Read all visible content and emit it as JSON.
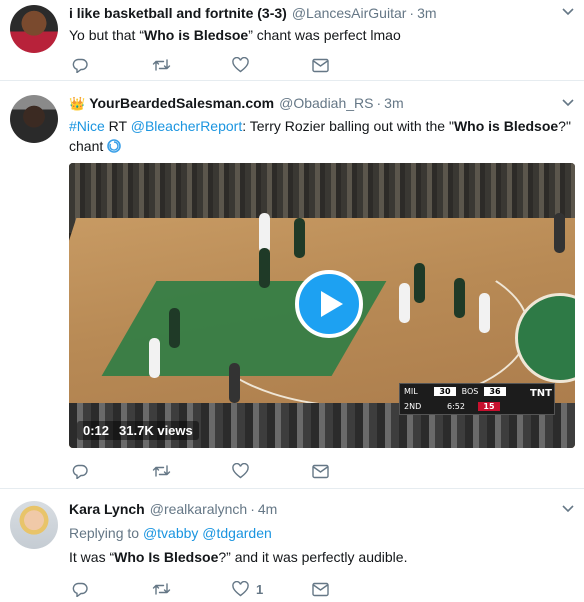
{
  "tweets": [
    {
      "name": "i like basketball and fortnite (3-3)",
      "handle": "@LancesAirGuitar",
      "dot": "·",
      "time": "3m",
      "text_a": "Yo but that “",
      "text_bold": "Who is Bledsoe",
      "text_b": "” chant was perfect lmao",
      "actions": {
        "reply_count": "",
        "retweet_count": "",
        "like_count": ""
      }
    },
    {
      "name": "YourBeardedSalesman.com",
      "handle": "@Obadiah_RS",
      "dot": "·",
      "time": "3m",
      "hashtag": "#Nice",
      "rt": " RT ",
      "mention": "@BleacherReport",
      "text_a": ": Terry Rozier balling out with the \"",
      "text_bold": "Who is Bledsoe",
      "text_b": "?\" chant",
      "video": {
        "duration": "0:12",
        "views": "31.7K views",
        "scorebug": {
          "team1": "MIL",
          "score1": "30",
          "team2": "BOS",
          "score2": "36",
          "quarter": "2ND",
          "clock": "6:52",
          "shot_clock": "15",
          "network": "TNT"
        }
      },
      "actions": {
        "reply_count": "",
        "retweet_count": "",
        "like_count": ""
      }
    },
    {
      "name": "Kara Lynch",
      "handle": "@realkaralynch",
      "dot": "·",
      "time": "4m",
      "replying_label": "Replying to ",
      "reply_mention_1": "@tvabby",
      "reply_mention_2": "@tdgarden",
      "text_a": "It was “",
      "text_bold": "Who Is Bledsoe",
      "text_b": "?” and it was perfectly audible.",
      "actions": {
        "reply_count": "",
        "retweet_count": "",
        "like_count": "1"
      }
    }
  ],
  "colors": {
    "link": "#1b95e0",
    "muted": "#657786",
    "play": "#1da1f2"
  },
  "icons": [
    "reply-icon",
    "retweet-icon",
    "like-icon",
    "dm-icon",
    "caret-down-icon",
    "crown-icon",
    "cyclone-icon",
    "play-icon"
  ]
}
